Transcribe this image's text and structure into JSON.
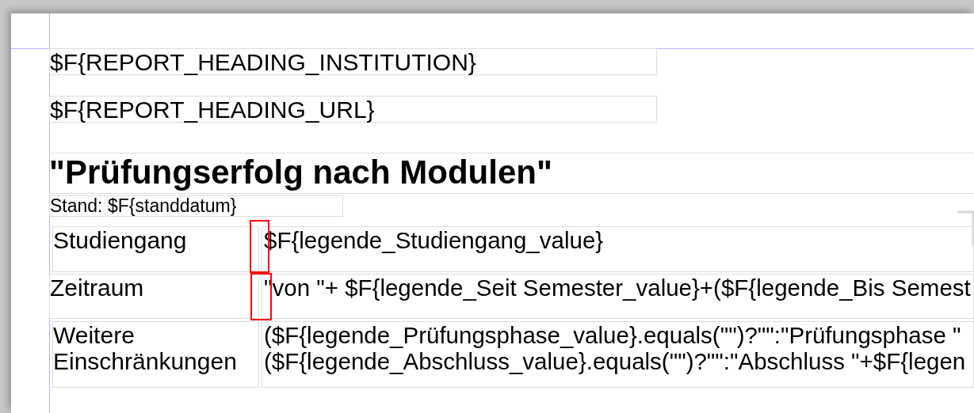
{
  "header_fields": [
    {
      "text": "$F{REPORT_HEADING_INSTITUTION}"
    },
    {
      "text": "$F{REPORT_HEADING_URL}"
    }
  ],
  "title": "\"Prüfungserfolg nach Modulen\"",
  "stand": {
    "label": "Stand:",
    "value": "$F{standdatum}"
  },
  "legend_rows": [
    {
      "label_lines": [
        "Studiengang"
      ],
      "value_lines": [
        "$F{legende_Studiengang_value}"
      ],
      "flagged": true
    },
    {
      "label_lines": [
        "Zeitraum"
      ],
      "value_lines": [
        "\"von \"+ $F{legende_Seit Semester_value}+($F{legende_Bis Semest"
      ],
      "flagged": true
    },
    {
      "label_lines": [
        "Weitere",
        "Einschränkungen"
      ],
      "value_lines": [
        "($F{legende_Prüfungsphase_value}.equals(\"\")?\"\":\"Prüfungsphase \"",
        "($F{legende_Abschluss_value}.equals(\"\")?\"\":\"Abschluss \"+$F{legen"
      ],
      "flagged": false
    }
  ]
}
